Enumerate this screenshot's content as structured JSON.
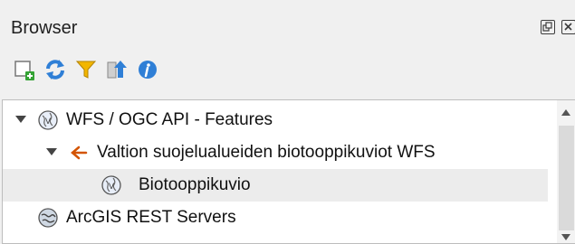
{
  "panel": {
    "title": "Browser",
    "buttons": {
      "float_icon": "float-icon",
      "close_icon": "close-icon"
    }
  },
  "toolbar": {
    "icons": [
      "add-selected-layers-icon",
      "refresh-icon",
      "filter-icon",
      "collapse-all-icon",
      "properties-info-icon"
    ]
  },
  "tree": {
    "items": [
      {
        "label": "WFS / OGC API - Features",
        "icon": "wfs-globe-icon",
        "expanded": true
      },
      {
        "label": "Valtion suojelualueiden biotooppikuviot WFS",
        "icon": "connection-icon",
        "expanded": true
      },
      {
        "label": "Biotooppikuvio",
        "icon": "layer-globe-icon",
        "selected": true
      },
      {
        "label": "ArcGIS REST Servers",
        "icon": "arcgis-globe-icon"
      }
    ]
  },
  "colors": {
    "accent_blue": "#2f7fd6",
    "filter_yellow": "#f2b600",
    "connection_orange": "#d35400"
  }
}
